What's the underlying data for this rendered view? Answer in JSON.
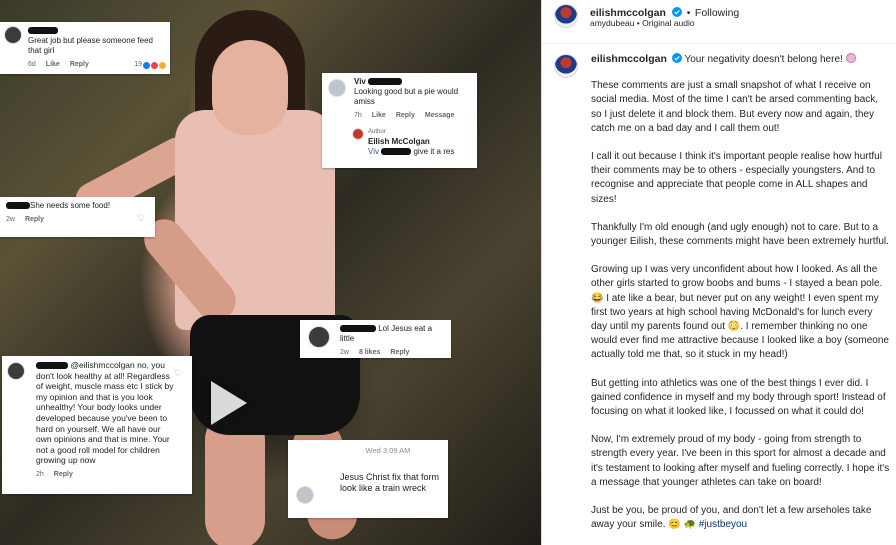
{
  "post": {
    "author": "eilishmccolgan",
    "follow_separator": "•",
    "follow_label": "Following",
    "sub_user": "amydubeau",
    "sub_separator": "•",
    "audio_label": "Original audio",
    "caption_intro": "Your negativity doesn't belong here!",
    "paragraphs": [
      "These comments are just a small snapshot of what I receive on social media. Most of the time I can't be arsed commenting back, so I just delete it and block them. But every now and again, they catch me on a bad day and I call them out!",
      "I call it out because I think it's important people realise how hurtful their comments may be to others - especially youngsters. And to recognise and appreciate that people come in ALL shapes and sizes!",
      "Thankfully I'm old enough (and ugly enough) not to care. But to a younger Eilish, these comments might have been extremely hurtful.",
      "Growing up I was very unconfident about how I looked. As all the other girls started to grow boobs and bums - I stayed a bean pole. 😂 I ate like a bear, but never put on any weight! I even spent my first two years at high school having McDonald's for lunch every day until my parents found out 😳. I remember thinking no one would ever find me attractive because I looked like a boy (someone actually told me that, so it stuck in my head!)",
      "But getting into athletics was one of the best things I ever did. I gained confidence in myself and my body through sport! Instead of focusing on what it looked like, I focussed on what it could do!",
      "Now, I'm extremely proud of my body - going from strength to strength every year. I've been in this sport for almost a decade and it's testament to looking after myself and fueling correctly. I hope it's a message that younger athletes can take on board!"
    ],
    "closing": "Just be you, be proud of you, and don't let a few arseholes take away your smile. 😊 🐢",
    "hashtag": "#justbeyou"
  },
  "comments": {
    "c1": {
      "text": "Great job but please someone feed that girl",
      "time": "6d",
      "like": "Like",
      "reply": "Reply",
      "count": "19"
    },
    "c2": {
      "name": "Viv",
      "text": "Looking good but a pie would amiss",
      "time": "7h",
      "like": "Like",
      "reply": "Reply",
      "more": "Message"
    },
    "c2r": {
      "badge": "Author",
      "name": "Eilish McColgan",
      "mention": "Viv",
      "text": "give it a res"
    },
    "c3": {
      "text": "She needs some food!",
      "time": "2w",
      "reply": "Reply"
    },
    "c4": {
      "text": "Lol Jesus eat a little",
      "time": "2w",
      "likes": "8 likes",
      "reply": "Reply"
    },
    "c5": {
      "text": "@eilishmccolgan no, you don't look healthy at all! Regardless of weight, muscle mass etc I stick by my opinion and that is you look unhealthy! Your body looks under developed because you've been to hard on yourself. We all have our own opinions and that is mine. Your not a good roll model for children growing up now",
      "time": "2h",
      "reply": "Reply"
    },
    "c6": {
      "stamp": "Wed 3:09 AM",
      "text": "Jesus Christ fix that form look like a train wreck"
    }
  },
  "icons": {
    "verified_color": "#0095f6",
    "link_color": "#00376b"
  }
}
